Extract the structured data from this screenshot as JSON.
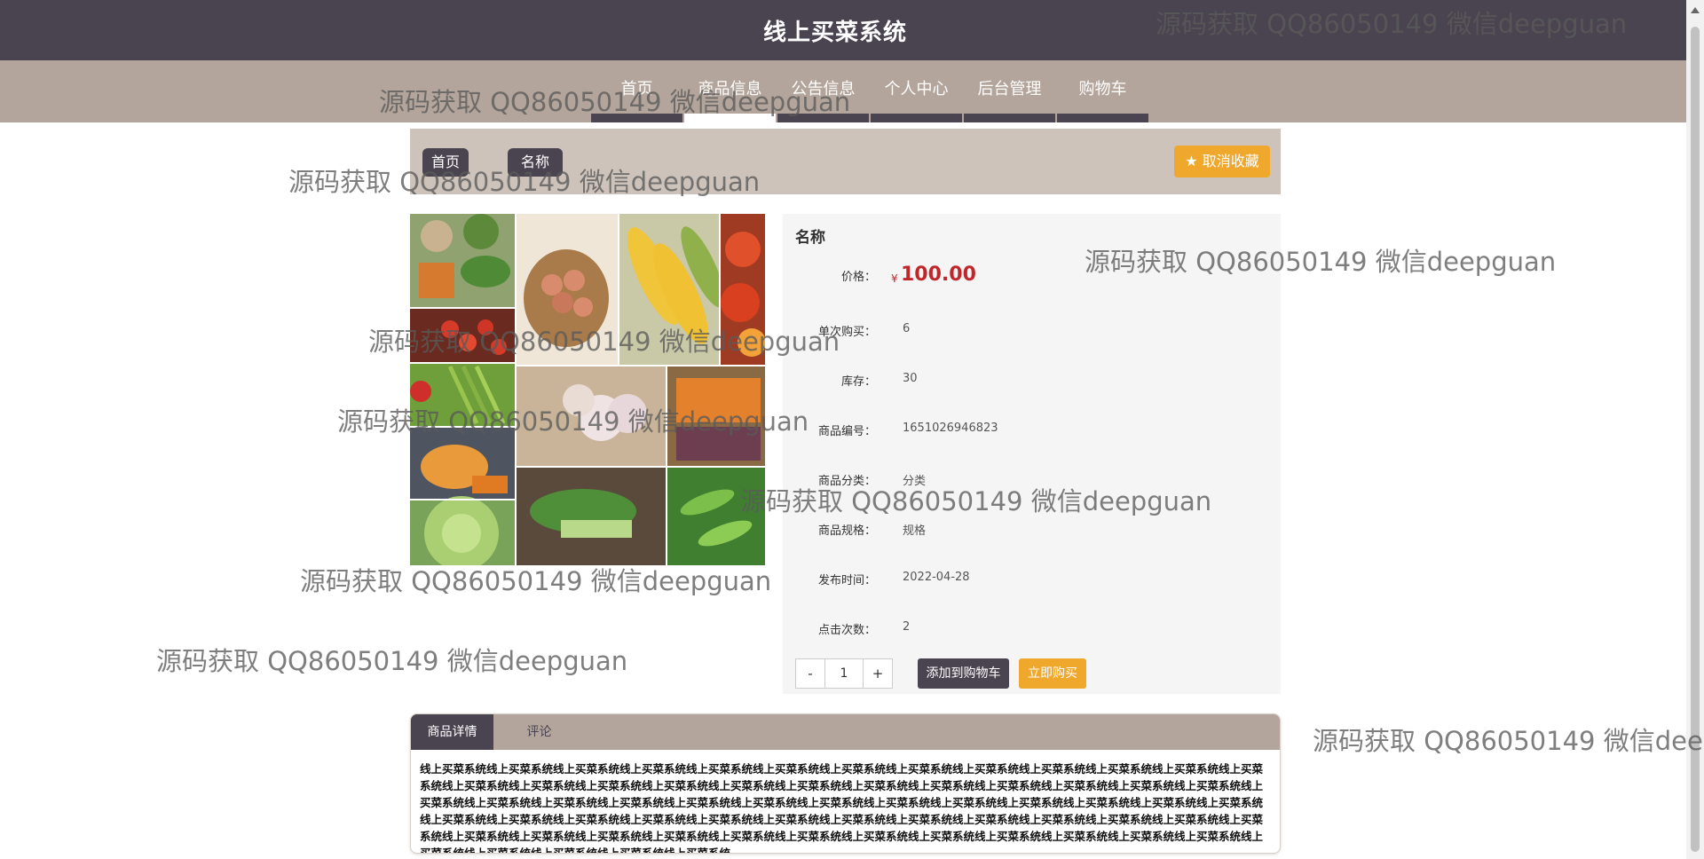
{
  "header": {
    "title": "线上买菜系统"
  },
  "nav": {
    "items": [
      {
        "label": "首页"
      },
      {
        "label": "商品信息"
      },
      {
        "label": "公告信息"
      },
      {
        "label": "个人中心"
      },
      {
        "label": "后台管理"
      },
      {
        "label": "购物车"
      }
    ],
    "active": "商品信息"
  },
  "breadcrumb": {
    "home": "首页",
    "current": "名称"
  },
  "favorite_button": {
    "label": "取消收藏",
    "icon": "star-icon"
  },
  "product": {
    "image_alt": "vegetables collage",
    "name": "名称",
    "price_label": "价格：",
    "currency": "¥",
    "price": "100.00",
    "fields": [
      {
        "label": "单次购买：",
        "value": "6"
      },
      {
        "label": "库存：",
        "value": "30"
      },
      {
        "label": "商品编号：",
        "value": "1651026946823"
      },
      {
        "label": "商品分类：",
        "value": "分类"
      },
      {
        "label": "商品规格：",
        "value": "规格"
      },
      {
        "label": "发布时间：",
        "value": "2022-04-28"
      },
      {
        "label": "点击次数：",
        "value": "2"
      }
    ],
    "quantity": "1",
    "minus": "-",
    "plus": "+",
    "add_to_cart": "添加到购物车",
    "buy_now": "立即购买"
  },
  "tabs": {
    "items": [
      {
        "label": "商品详情"
      },
      {
        "label": "评论"
      }
    ],
    "detail_text": "线上买菜系统线上买菜系统线上买菜系统线上买菜系统线上买菜系统线上买菜系统线上买菜系统线上买菜系统线上买菜系统线上买菜系统线上买菜系统线上买菜系统线上买菜系统线上买菜系统线上买菜系统线上买菜系统线上买菜系统线上买菜系统线上买菜系统线上买菜系统线上买菜系统线上买菜系统线上买菜系统线上买菜系统线上买菜系统线上买菜系统线上买菜系统线上买菜系统线上买菜系统线上买菜系统线上买菜系统线上买菜系统线上买菜系统线上买菜系统线上买菜系统线上买菜系统线上买菜系统线上买菜系统线上买菜系统线上买菜系统线上买菜系统线上买菜系统线上买菜系统线上买菜系统线上买菜系统线上买菜系统线上买菜系统线上买菜系统线上买菜系统线上买菜系统线上买菜系统线上买菜系统线上买菜系统线上买菜系统线上买菜系统线上买菜系统线上买菜系统线上买菜系统线上买菜系统线上买菜系统线上买菜系统线上买菜系统线上买菜系统线上买菜系统线上买菜系统线上买菜系统线上买菜系统线上买菜系统"
  },
  "watermark": {
    "text": "源码获取 QQ86050149 微信deepguan"
  },
  "colors": {
    "header": "#4a4450",
    "nav": "#b3a59b",
    "accent": "#f0a82c",
    "price": "#c0272d"
  }
}
